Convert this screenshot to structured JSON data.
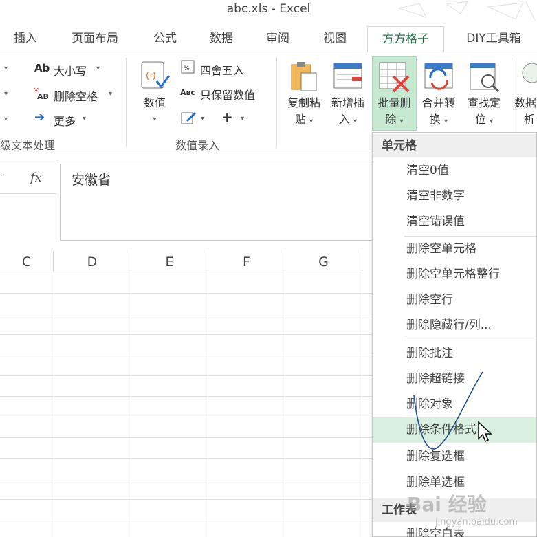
{
  "window": {
    "title": "abc.xls - Excel"
  },
  "tabs": [
    "插入",
    "页面布局",
    "公式",
    "数据",
    "审阅",
    "视图",
    "方方格子",
    "DIY工具箱"
  ],
  "ribbon": {
    "text_group": {
      "items": [
        "大小写",
        "删除空格",
        "更多"
      ],
      "label": "级文本处理"
    },
    "number_group": {
      "value_label": "数值",
      "items": [
        "四舍五入",
        "只保留数值"
      ],
      "label": "数值录入"
    },
    "buttons": {
      "paste_line1": "复制粘",
      "paste_line2": "贴",
      "insert_line1": "新增插",
      "insert_line2": "入",
      "delete_line1": "批量删",
      "delete_line2": "除",
      "merge_line1": "合并转",
      "merge_line2": "换",
      "find_line1": "查找定",
      "find_line2": "位",
      "analysis_line1": "数据",
      "analysis_line2": "析"
    }
  },
  "formula_bar": {
    "fx": "fx",
    "value": "安徽省"
  },
  "columns": [
    "C",
    "D",
    "E",
    "F",
    "G"
  ],
  "menu": {
    "section1": "单元格",
    "group1": [
      "清空0值",
      "清空非数字",
      "清空错误值"
    ],
    "group2": [
      "删除空单元格",
      "删除空单元格整行",
      "删除空行",
      "删除隐藏行/列..."
    ],
    "group3": [
      "删除批注",
      "删除超链接",
      "删除对象",
      "删除条件格式",
      "删除复选框",
      "删除单选框"
    ],
    "section2": "工作表",
    "group4": [
      "删除空白表"
    ],
    "highlighted": "删除条件格式"
  },
  "watermark": {
    "main": "Bai 经验",
    "sub": "jingyan.baidu.com"
  },
  "colors": {
    "accent": "#217346",
    "selected": "#c6e9d1",
    "highlight": "#d9efe0",
    "pen": "#1f4e8c"
  }
}
